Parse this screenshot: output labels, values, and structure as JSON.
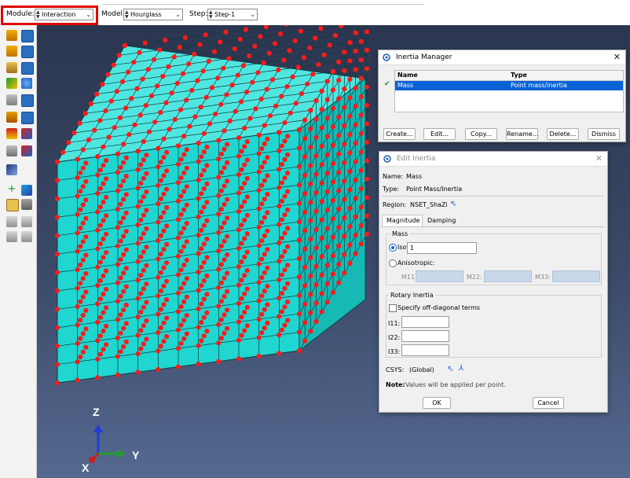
{
  "context_bar": {
    "module_label": "Module:",
    "module_value": "Interaction",
    "model_label": "Model:",
    "model_value": "Hourglass",
    "step_label": "Step:",
    "step_value": "Step-1"
  },
  "triad": {
    "z": "Z",
    "y": "Y",
    "x": "X"
  },
  "inertia_manager": {
    "title": "Inertia Manager",
    "col_name": "Name",
    "col_type": "Type",
    "rows": [
      {
        "check": "✔",
        "name": "Mass",
        "type": "Point mass/inertia"
      }
    ],
    "buttons": {
      "create": "Create...",
      "edit": "Edit...",
      "copy": "Copy...",
      "rename": "Rename...",
      "delete": "Delete...",
      "dismiss": "Dismiss"
    }
  },
  "edit_inertia": {
    "title": "Edit Inertia",
    "name_label": "Name:",
    "name_value": "Mass",
    "type_label": "Type:",
    "type_value": "Point Mass/Inertia",
    "region_label": "Region:",
    "region_value": "NSET_ShaZi",
    "tabs": [
      "Magnitude",
      "Damping"
    ],
    "mass_group": "Mass",
    "isotropic_label": "Isotropic:",
    "isotropic_value": "1",
    "anisotropic_label": "Anisotropic:",
    "m11_label": "M11:",
    "m22_label": "M22:",
    "m33_label": "M33:",
    "rotary_group": "Rotary Inertia",
    "offdiag_label": "Specify off-diagonal terms",
    "i11_label": "I11:",
    "i22_label": "I22:",
    "i33_label": "I33:",
    "csys_label": "CSYS:",
    "csys_value": "(Global)",
    "note_label": "Note:",
    "note_text": "Values will be applied per point.",
    "ok": "OK",
    "cancel": "Cancel"
  },
  "colors": {
    "viewport_top": "#2b3650",
    "mesh_face": "#1fd6d0",
    "node": "#ff1a1a",
    "selection": "#0a63d6",
    "highlight": "#e00000"
  }
}
